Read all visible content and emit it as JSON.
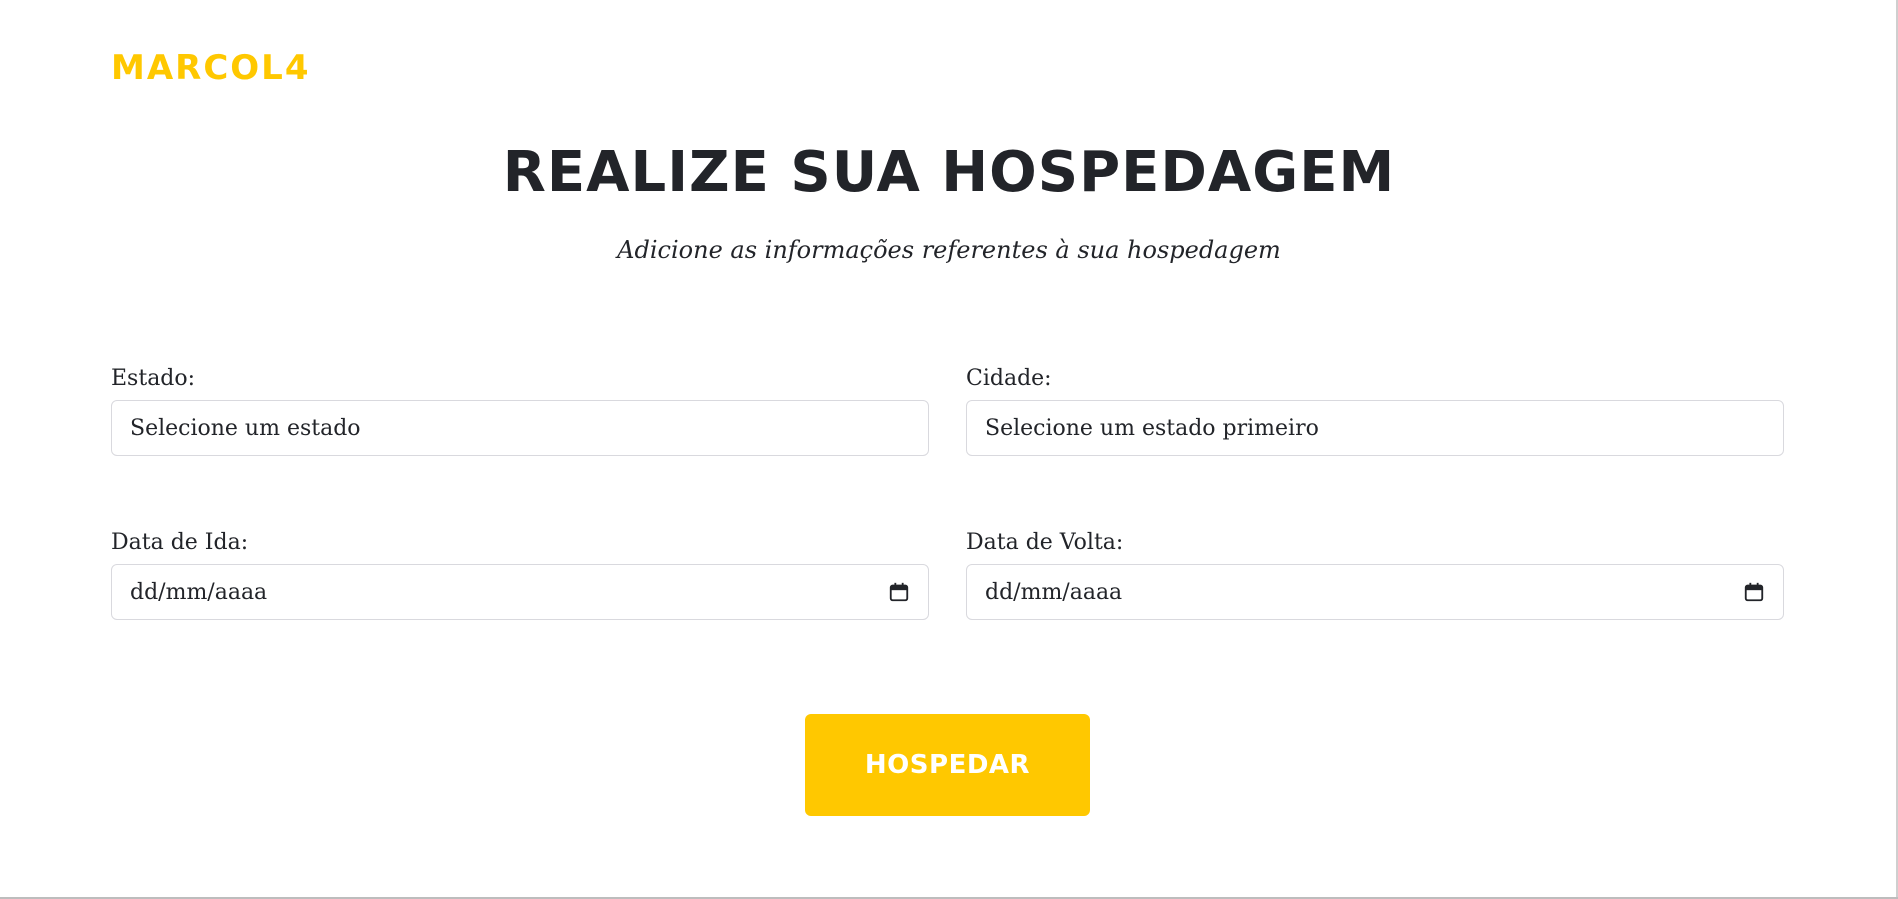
{
  "brand": {
    "logo_text": "MARCOL4",
    "accent_color": "#ffc800"
  },
  "header": {
    "title": "REALIZE SUA HOSPEDAGEM",
    "subtitle": "Adicione as informações referentes à sua hospedagem"
  },
  "form": {
    "estado": {
      "label": "Estado:",
      "value": "Selecione um estado"
    },
    "cidade": {
      "label": "Cidade:",
      "value": "Selecione um estado primeiro"
    },
    "data_ida": {
      "label": "Data de Ida:",
      "placeholder": "dd/mm/aaaa",
      "icon": "calendar-icon"
    },
    "data_volta": {
      "label": "Data de Volta:",
      "placeholder": "dd/mm/aaaa",
      "icon": "calendar-icon"
    },
    "submit_label": "HOSPEDAR"
  }
}
